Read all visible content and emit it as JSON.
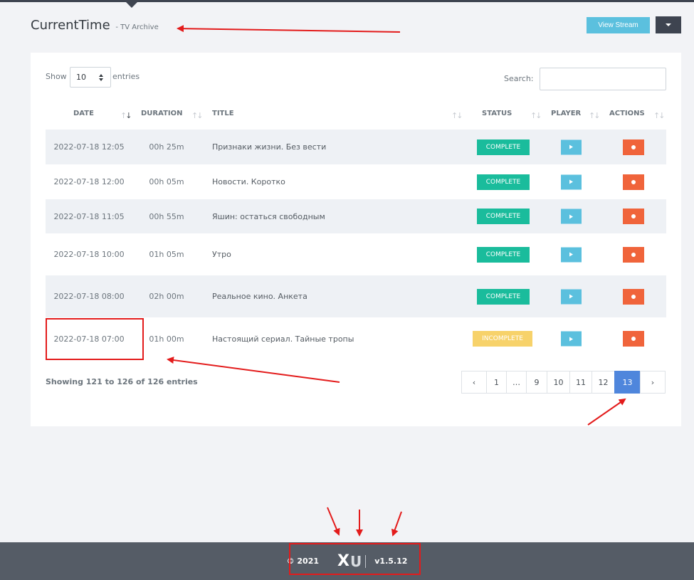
{
  "header": {
    "title": "CurrentTime",
    "subtitle": "- TV Archive",
    "view_stream_label": "View Stream",
    "dropdown_icon": "caret-down-icon"
  },
  "table_controls": {
    "show_label": "Show",
    "page_size": "10",
    "entries_label": "entries",
    "search_label": "Search:",
    "search_value": ""
  },
  "columns": {
    "date": "DATE",
    "duration": "DURATION",
    "title": "TITLE",
    "status": "STATUS",
    "player": "PLAYER",
    "actions": "ACTIONS"
  },
  "rows": [
    {
      "date": "2022-07-18 12:05",
      "duration": "00h 25m",
      "title": "Признаки жизни. Без вести",
      "status": "COMPLETE"
    },
    {
      "date": "2022-07-18 12:00",
      "duration": "00h 05m",
      "title": "Новости. Коротко",
      "status": "COMPLETE"
    },
    {
      "date": "2022-07-18 11:05",
      "duration": "00h 55m",
      "title": "Яшин: остаться свободным",
      "status": "COMPLETE"
    },
    {
      "date": "2022-07-18 10:00",
      "duration": "01h 05m",
      "title": "Утро",
      "status": "COMPLETE"
    },
    {
      "date": "2022-07-18 08:00",
      "duration": "02h 00m",
      "title": "Реальное кино. Анкета",
      "status": "COMPLETE"
    },
    {
      "date": "2022-07-18 07:00",
      "duration": "01h 00m",
      "title": "Настоящий сериал. Тайные тропы",
      "status": "INCOMPLETE"
    }
  ],
  "info_text": "Showing 121 to 126 of 126 entries",
  "pagination": {
    "prev": "‹",
    "pages": [
      "1",
      "…",
      "9",
      "10",
      "11",
      "12",
      "13"
    ],
    "active": "13",
    "next": "›"
  },
  "footer": {
    "copyright": "© 2021",
    "logo_x": "X",
    "logo_u": "U",
    "version": "v1.5.12"
  },
  "colors": {
    "complete": "#1abc9c",
    "incomplete": "#f7d26a",
    "play": "#5bc0de",
    "record": "#f0643b",
    "active_page": "#4f86dc",
    "annotation": "#e31b1b"
  }
}
